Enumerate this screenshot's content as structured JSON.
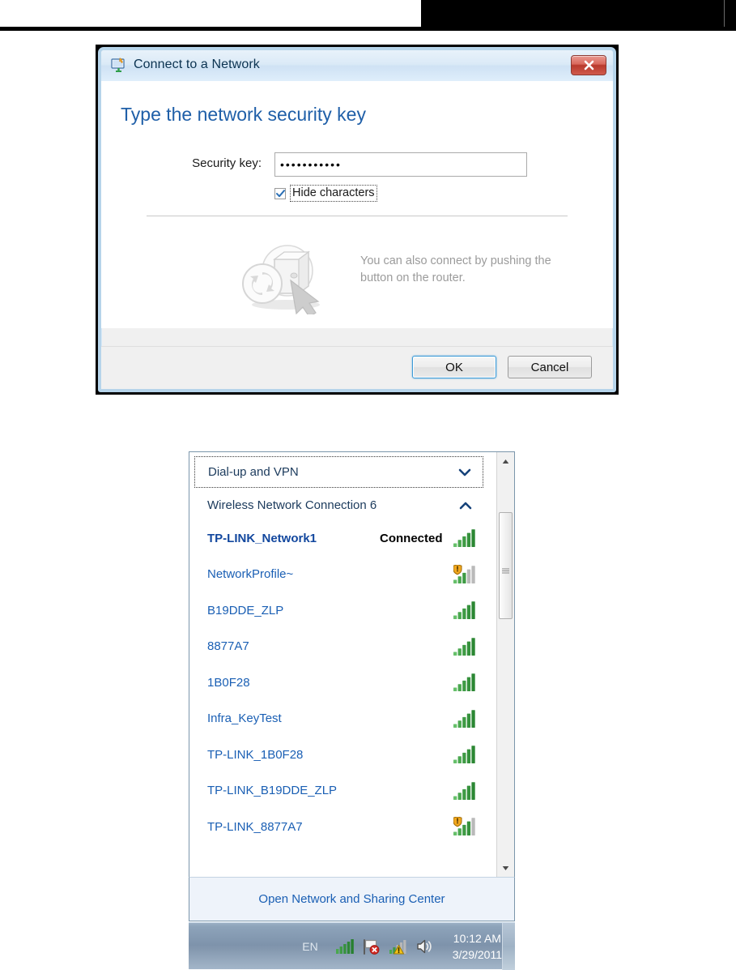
{
  "dialog": {
    "title": "Connect to a Network",
    "icon": "network-connect-icon",
    "close_label": "×",
    "heading": "Type the network security key",
    "security_key_label": "Security key:",
    "security_key_value": "•••••••••••",
    "hide_characters_label": "Hide characters",
    "hide_characters_checked": true,
    "wps_hint_line1": "You can also connect by pushing the",
    "wps_hint_line2": "button on the router.",
    "ok_label": "OK",
    "cancel_label": "Cancel"
  },
  "flyout": {
    "dialup_group_label": "Dial-up and VPN",
    "wireless_group_label": "Wireless Network Connection 6",
    "connected_status": "Connected",
    "networks": [
      {
        "name": "TP-LINK_Network1",
        "status": "Connected",
        "connected": true,
        "bars": 5,
        "secure_warning": false
      },
      {
        "name": "NetworkProfile~",
        "status": "",
        "connected": false,
        "bars": 3,
        "secure_warning": true
      },
      {
        "name": "B19DDE_ZLP",
        "status": "",
        "connected": false,
        "bars": 5,
        "secure_warning": false
      },
      {
        "name": "8877A7",
        "status": "",
        "connected": false,
        "bars": 5,
        "secure_warning": false
      },
      {
        "name": "1B0F28",
        "status": "",
        "connected": false,
        "bars": 5,
        "secure_warning": false
      },
      {
        "name": "Infra_KeyTest",
        "status": "",
        "connected": false,
        "bars": 5,
        "secure_warning": false
      },
      {
        "name": "TP-LINK_1B0F28",
        "status": "",
        "connected": false,
        "bars": 5,
        "secure_warning": false
      },
      {
        "name": "TP-LINK_B19DDE_ZLP",
        "status": "",
        "connected": false,
        "bars": 5,
        "secure_warning": false
      },
      {
        "name": "TP-LINK_8877A7",
        "status": "",
        "connected": false,
        "bars": 4,
        "secure_warning": true
      }
    ],
    "footer_link": "Open Network and Sharing Center"
  },
  "taskbar": {
    "language": "EN",
    "icons": [
      "wireless-signal-icon",
      "network-error-icon",
      "network-warning-icon",
      "volume-icon"
    ],
    "time": "10:12 AM",
    "date": "3/29/2011"
  },
  "colors": {
    "link": "#1a5fb4",
    "heading": "#1f5fa8",
    "signal_green": "#3f9b45",
    "signal_grey": "#b4b4b4",
    "close_red": "#b8392c"
  }
}
